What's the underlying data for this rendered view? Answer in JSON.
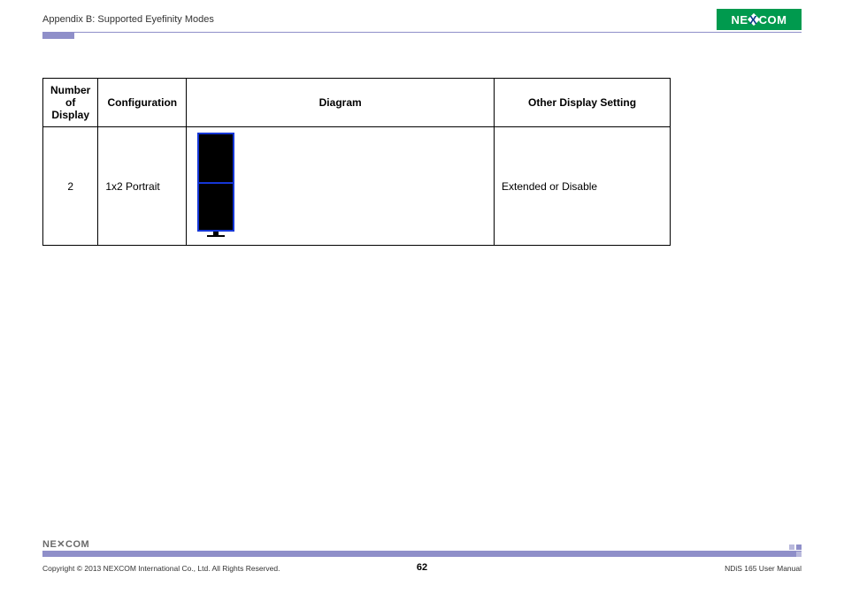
{
  "header": {
    "appendix": "Appendix B: Supported Eyefinity Modes",
    "logo_left": "NE",
    "logo_right": "COM"
  },
  "table": {
    "headers": {
      "num": "Number of Display",
      "conf": "Configuration",
      "diag": "Diagram",
      "other": "Other Display Setting"
    },
    "row": {
      "num": "2",
      "conf": "1x2 Portrait",
      "other": "Extended or Disable"
    }
  },
  "footer": {
    "logo_left": "NE",
    "logo_right": "COM",
    "copyright": "Copyright © 2013 NEXCOM International Co., Ltd. All Rights Reserved.",
    "page": "62",
    "doc": "NDiS 165 User Manual"
  }
}
